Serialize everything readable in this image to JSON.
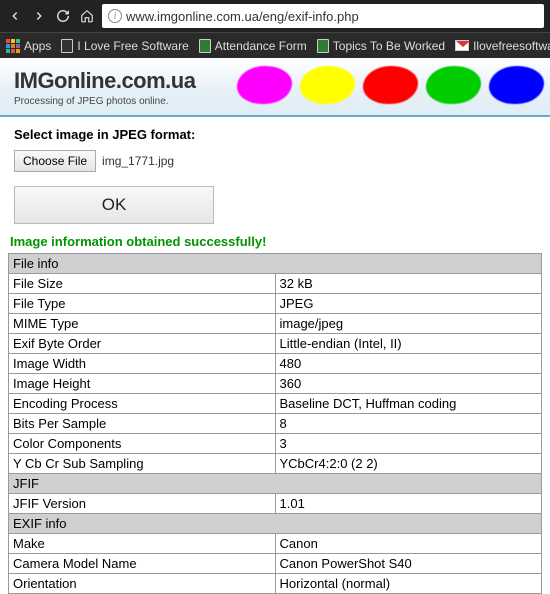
{
  "browser": {
    "url": "www.imgonline.com.ua/eng/exif-info.php",
    "bookmarks": {
      "apps": "Apps",
      "ilove": "I Love Free Software",
      "attendance": "Attendance Form",
      "topics": "Topics To Be Worked",
      "ilovemail": "Ilovefreesoftware.com"
    }
  },
  "header": {
    "title": "IMGonline.com.ua",
    "subtitle": "Processing of JPEG photos online."
  },
  "select": {
    "label": "Select image in JPEG format:",
    "choose_btn": "Choose File",
    "filename": "img_1771.jpg"
  },
  "ok_label": "OK",
  "success": "Image information obtained successfully!",
  "sections": {
    "file_info": "File info",
    "jfif": "JFIF",
    "exif": "EXIF info"
  },
  "rows": {
    "file_size": {
      "k": "File Size",
      "v": "32 kB"
    },
    "file_type": {
      "k": "File Type",
      "v": "JPEG"
    },
    "mime": {
      "k": "MIME Type",
      "v": "image/jpeg"
    },
    "byte_order": {
      "k": "Exif Byte Order",
      "v": "Little-endian (Intel, II)"
    },
    "width": {
      "k": "Image Width",
      "v": "480"
    },
    "height": {
      "k": "Image Height",
      "v": "360"
    },
    "encoding": {
      "k": "Encoding Process",
      "v": "Baseline DCT, Huffman coding"
    },
    "bps": {
      "k": "Bits Per Sample",
      "v": "8"
    },
    "colorcomp": {
      "k": "Color Components",
      "v": "3"
    },
    "ycbcr": {
      "k": "Y Cb Cr Sub Sampling",
      "v": "YCbCr4:2:0 (2 2)"
    },
    "jfif_v": {
      "k": "JFIF Version",
      "v": "1.01"
    },
    "make": {
      "k": "Make",
      "v": "Canon"
    },
    "model": {
      "k": "Camera Model Name",
      "v": "Canon PowerShot S40"
    },
    "orient": {
      "k": "Orientation",
      "v": "Horizontal (normal)"
    }
  }
}
